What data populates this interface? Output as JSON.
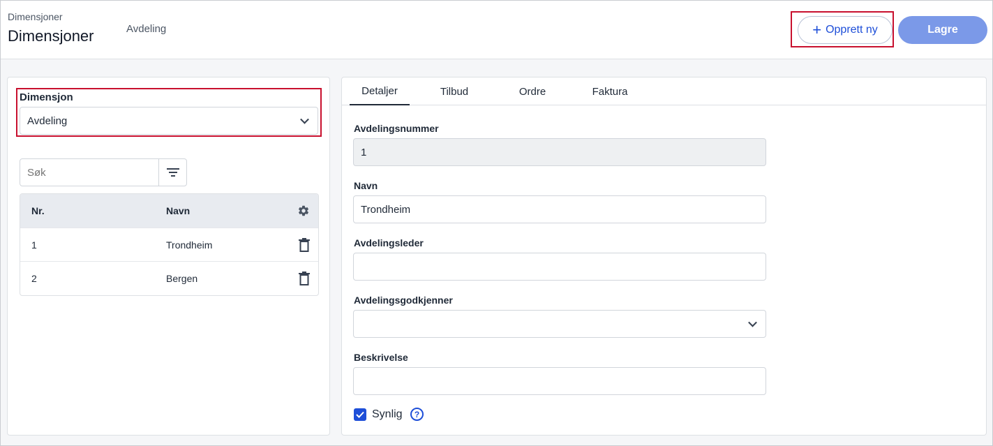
{
  "header": {
    "breadcrumb": "Dimensjoner",
    "title": "Dimensjoner",
    "tab": "Avdeling",
    "new_button": "Opprett ny",
    "save_button": "Lagre"
  },
  "left": {
    "dimension_label": "Dimensjon",
    "dimension_value": "Avdeling",
    "search_placeholder": "Søk",
    "table": {
      "columns": [
        "Nr.",
        "Navn"
      ],
      "rows": [
        {
          "nr": "1",
          "navn": "Trondheim"
        },
        {
          "nr": "2",
          "navn": "Bergen"
        }
      ]
    }
  },
  "right": {
    "tabs": [
      "Detaljer",
      "Tilbud",
      "Ordre",
      "Faktura"
    ],
    "fields": {
      "number_label": "Avdelingsnummer",
      "number_value": "1",
      "name_label": "Navn",
      "name_value": "Trondheim",
      "leader_label": "Avdelingsleder",
      "leader_value": "",
      "approver_label": "Avdelingsgodkjenner",
      "approver_value": "",
      "description_label": "Beskrivelse",
      "description_value": ""
    },
    "visible_label": "Synlig"
  },
  "colors": {
    "accent": "#1d4ed8",
    "save": "#7b99e8",
    "highlight": "#c8102e"
  }
}
